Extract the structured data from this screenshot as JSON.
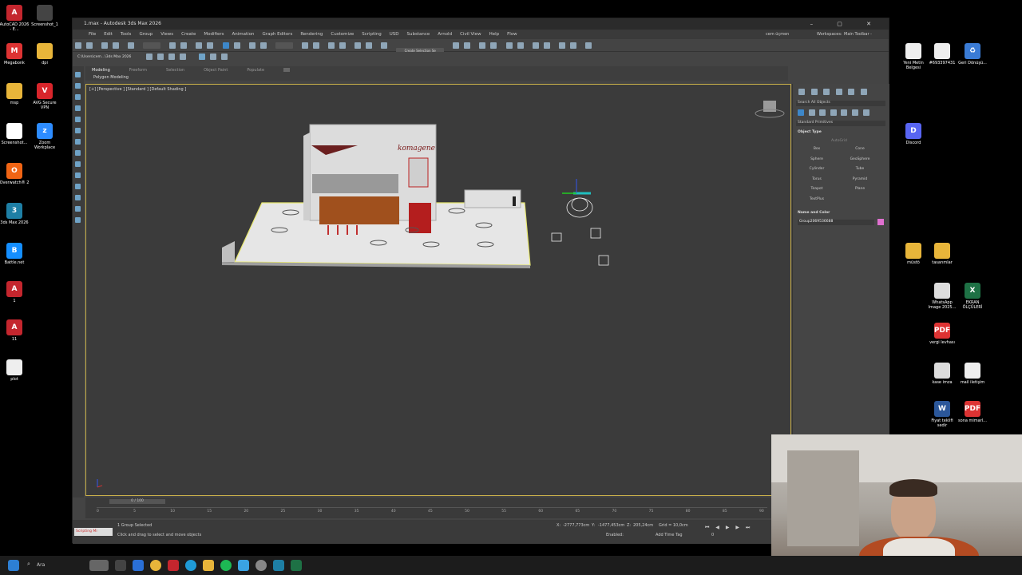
{
  "window": {
    "title": "1.max - Autodesk 3ds Max 2026",
    "menu": [
      "File",
      "Edit",
      "Tools",
      "Group",
      "Views",
      "Create",
      "Modifiers",
      "Animation",
      "Graph Editors",
      "Rendering",
      "Customize",
      "Scripting",
      "USD",
      "Substance",
      "Arnold",
      "Civil View",
      "Help",
      "Flow"
    ],
    "user": "cem üçmen",
    "workspaces_label": "Workspaces:",
    "workspace": "Main Toolbar - modular",
    "path": "C:\\Users\\cem...\\3ds Max 2026",
    "create_selection_set": "Create Selection Se"
  },
  "ribbon": {
    "tabs": [
      "Modeling",
      "Freeform",
      "Selection",
      "Object Paint",
      "Populate"
    ],
    "subtab": "Polygon Modeling"
  },
  "viewport": {
    "label": "[+] [Perspective ] [Standard ] [Default Shading ]",
    "sign_text": "komagene"
  },
  "command_panel": {
    "search_placeholder": "Search All Objects",
    "category": "Standard Primitives",
    "object_type_title": "Object Type",
    "autogrid": "AutoGrid",
    "buttons": [
      "Box",
      "Cone",
      "Sphere",
      "GeoSphere",
      "Cylinder",
      "Tube",
      "Torus",
      "Pyramid",
      "Teapot",
      "Plane",
      "TextPlus"
    ],
    "name_color_title": "Name and Color",
    "object_name": "Group2069536688",
    "object_color": "#e070d0"
  },
  "timeline": {
    "frame_display": "0 / 100",
    "ticks": [
      "0",
      "5",
      "10",
      "15",
      "20",
      "25",
      "30",
      "35",
      "40",
      "45",
      "50",
      "55",
      "60",
      "65",
      "70",
      "75",
      "80",
      "85",
      "90"
    ]
  },
  "status": {
    "selection": "1 Group Selected",
    "prompt": "Click and drag to select and move objects",
    "maxscript": "Scripting Mi",
    "x_label": "X:",
    "x_value": "-2777,773cm",
    "y_label": "Y:",
    "y_value": "-1477,453cm",
    "z_label": "Z:",
    "z_value": "205,24cm",
    "grid": "Grid = 10,0cm",
    "enabled": "Enabled:",
    "add_time_tag": "Add Time Tag",
    "frame": "0"
  },
  "desktop_left": [
    {
      "label": "AutoCAD 2026 - E...",
      "color": "#c4262e",
      "glyph": "A"
    },
    {
      "label": "Screenshot_1",
      "color": "#444",
      "glyph": ""
    },
    {
      "label": "Megabonk",
      "color": "#d33",
      "glyph": "M"
    },
    {
      "label": "dpi",
      "color": "#e8b53a",
      "glyph": ""
    },
    {
      "label": "msp",
      "color": "#e8b53a",
      "glyph": ""
    },
    {
      "label": "AVG Secure VPN",
      "color": "#d8252b",
      "glyph": "V"
    },
    {
      "label": "Screenshot...",
      "color": "#fff",
      "glyph": ""
    },
    {
      "label": "Zoom Workplace",
      "color": "#2d8cff",
      "glyph": "z"
    },
    {
      "label": "Overwatch® 2",
      "color": "#f06414",
      "glyph": "O"
    },
    {
      "label": "3ds Max 2026",
      "color": "#1e7fa5",
      "glyph": "3"
    },
    {
      "label": "Battle.net",
      "color": "#148eff",
      "glyph": "B"
    },
    {
      "label": "1",
      "color": "#c4262e",
      "glyph": "A"
    },
    {
      "label": "11",
      "color": "#c4262e",
      "glyph": "A"
    },
    {
      "label": "plot",
      "color": "#eee",
      "glyph": ""
    }
  ],
  "desktop_right": [
    {
      "label": "Yeni Metin Belgesi",
      "color": "#eee",
      "glyph": ""
    },
    {
      "label": "#693397431",
      "color": "#eee",
      "glyph": ""
    },
    {
      "label": "Geri Dönüşü...",
      "color": "#3a7bd5",
      "glyph": "♻"
    },
    {
      "label": "Discord",
      "color": "#5865f2",
      "glyph": "D"
    },
    {
      "label": "müstö",
      "color": "#e8b53a",
      "glyph": ""
    },
    {
      "label": "tasarımlar",
      "color": "#e8b53a",
      "glyph": ""
    },
    {
      "label": "WhatsApp Image 2025...",
      "color": "#ddd",
      "glyph": ""
    },
    {
      "label": "EKRAN ÖLÇÜLERİ",
      "color": "#1e7145",
      "glyph": "X"
    },
    {
      "label": "vergi levhası",
      "color": "#d33",
      "glyph": "PDF"
    },
    {
      "label": "kase imza",
      "color": "#ddd",
      "glyph": ""
    },
    {
      "label": "mail iletişim",
      "color": "#eee",
      "glyph": ""
    },
    {
      "label": "Fiyat teklifi sedir",
      "color": "#2b579a",
      "glyph": "W"
    },
    {
      "label": "sona mimarl...",
      "color": "#d33",
      "glyph": "PDF"
    }
  ],
  "taskbar": {
    "search": "Ara"
  }
}
